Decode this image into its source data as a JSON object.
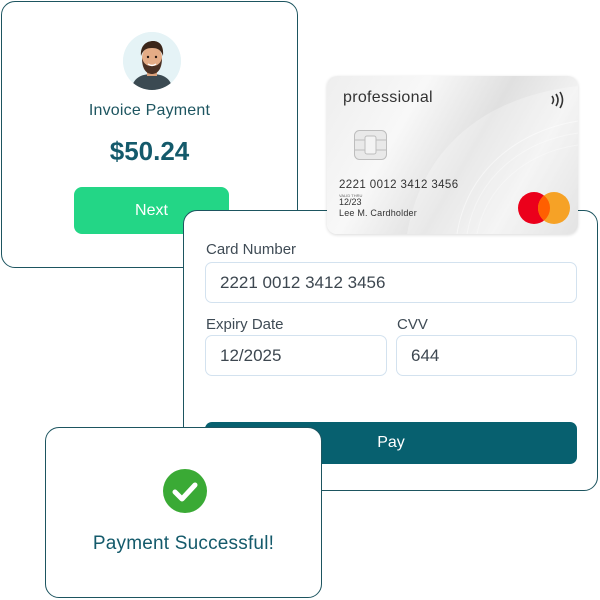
{
  "colors": {
    "border": "#1d5560",
    "primary_text": "#145a6b",
    "next_button": "#23d686",
    "pay_button": "#07606f",
    "success_green": "#3aaa35",
    "mastercard_red": "#eb001b",
    "mastercard_orange": "#f79e1b"
  },
  "invoice": {
    "avatar_icon": "person-avatar",
    "title": "Invoice Payment",
    "amount": "$50.24",
    "next_label": "Next"
  },
  "card": {
    "brand": "professional",
    "number": "2221 0012 3412 3456",
    "valid_thru_label": "VALID THRU",
    "expiry": "12/23",
    "holder": "Lee M. Cardholder",
    "contactless_icon": "contactless-icon",
    "network_icon": "mastercard-logo"
  },
  "form": {
    "card_number_label": "Card Number",
    "card_number_value": "2221 0012 3412 3456",
    "expiry_label": "Expiry Date",
    "expiry_value": "12/2025",
    "cvv_label": "CVV",
    "cvv_value": "644",
    "pay_label": "Pay"
  },
  "success": {
    "icon": "check-circle-icon",
    "message": "Payment Successful!"
  }
}
